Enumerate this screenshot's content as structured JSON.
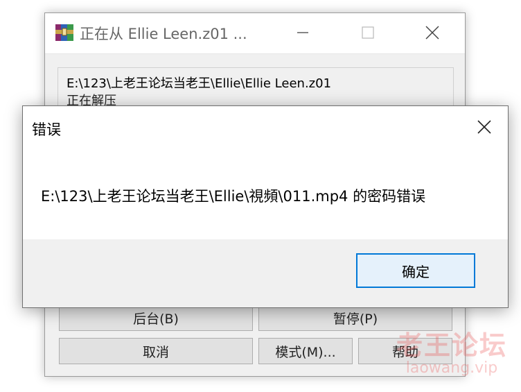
{
  "background_window": {
    "title": "正在从 Ellie Leen.z01 ...",
    "controls": {
      "minimize": "—",
      "maximize": "☐",
      "close": "✕"
    },
    "archive_path": "E:\\123\\上老王论坛当老王\\Ellie\\Ellie Leen.z01",
    "status": "正在解压",
    "buttons": {
      "background": "后台(B)",
      "pause": "暂停(P)",
      "cancel": "取消",
      "mode": "模式(M)...",
      "help": "帮助"
    }
  },
  "error_dialog": {
    "title": "错误",
    "message": "E:\\123\\上老王论坛当老王\\Ellie\\視頻\\011.mp4 的密码错误",
    "ok_label": "确定"
  },
  "watermark": {
    "main": "老王论坛",
    "sub": "laowang.vip"
  },
  "colors": {
    "accent": "#0078d7",
    "dialog_footer": "#f0f0f0",
    "watermark": "#eb4646"
  }
}
